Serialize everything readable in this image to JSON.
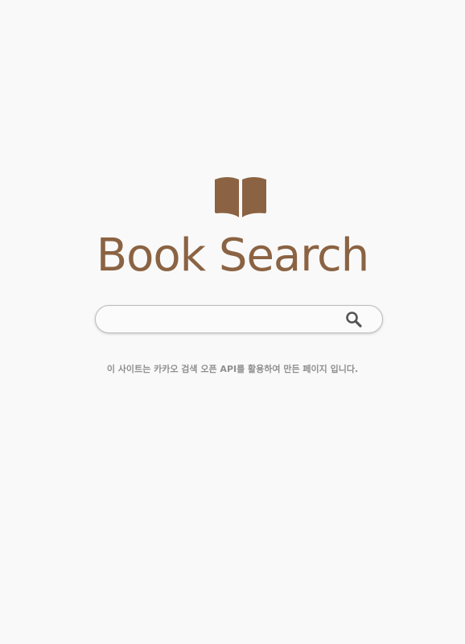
{
  "app": {
    "title": "Book Search",
    "logo_icon": "open-book-icon",
    "brand_color": "#8b6343"
  },
  "search": {
    "value": "",
    "placeholder": "",
    "button_icon": "search-icon"
  },
  "footer": {
    "notice": "이 사이트는 카카오 검색 오픈 API를 활용하여 만든 페이지 입니다."
  }
}
